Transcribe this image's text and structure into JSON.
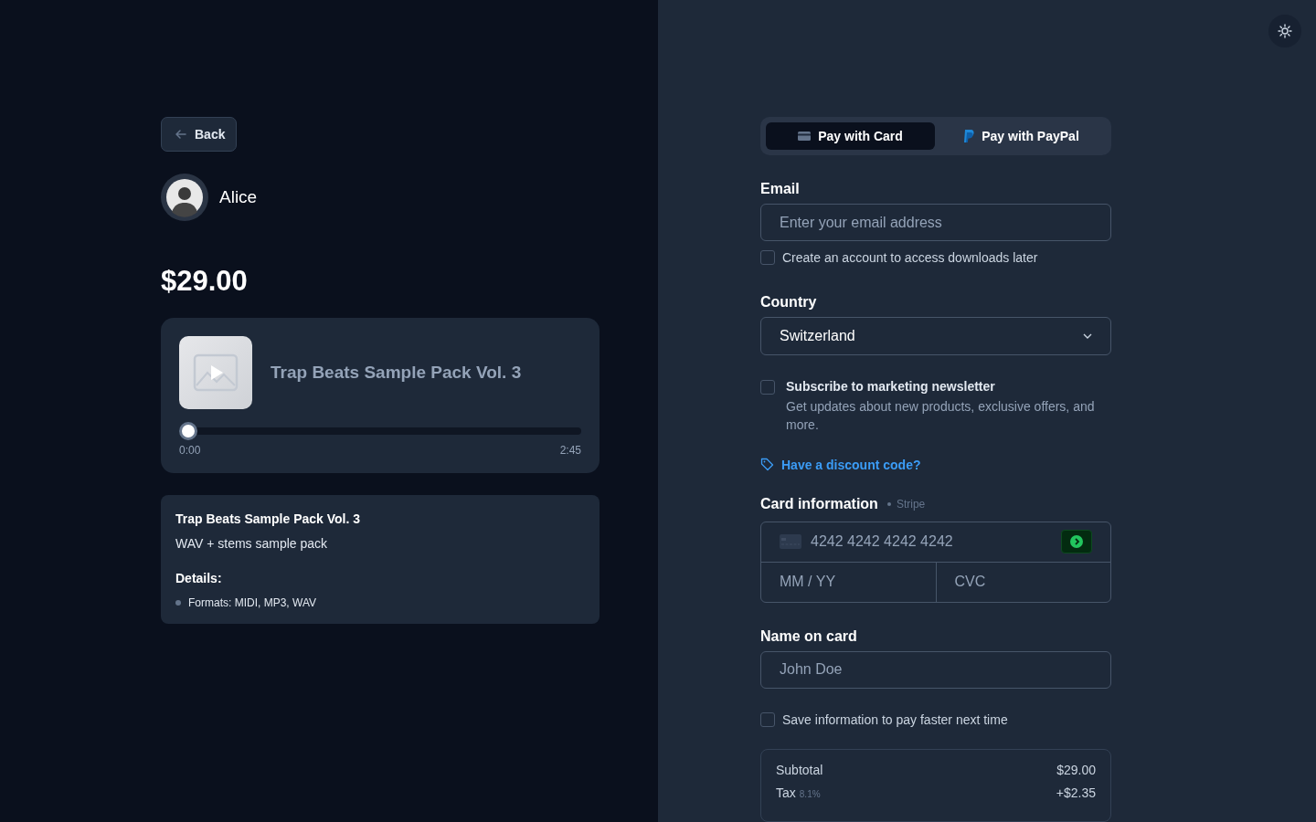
{
  "back_button": {
    "label": "Back"
  },
  "seller": {
    "name": "Alice"
  },
  "price": "$29.00",
  "player": {
    "title": "Trap Beats Sample Pack Vol. 3",
    "level": 0,
    "elapsed": "0:00",
    "duration": "2:45"
  },
  "product": {
    "title": "Trap Beats Sample Pack Vol. 3",
    "subtitle": "WAV + stems sample pack",
    "details_heading": "Details:",
    "details": [
      "Formats: MIDI, MP3, WAV"
    ]
  },
  "payment_tabs": [
    {
      "label": "Pay with Card",
      "kind": "card",
      "selected": true
    },
    {
      "label": "Pay with PayPal",
      "kind": "paypal",
      "selected": false
    }
  ],
  "email": {
    "label": "Email",
    "placeholder": "Enter your email address"
  },
  "create_account": {
    "label": "Create an account to access downloads later",
    "checked": false
  },
  "country": {
    "label": "Country",
    "value": "Switzerland"
  },
  "newsletter": {
    "label": "Subscribe to marketing newsletter",
    "description": "Get updates about new products, exclusive offers, and more.",
    "checked": false
  },
  "discount_link": "Have a discount code?",
  "card": {
    "label": "Card information",
    "provider": "Stripe",
    "number_placeholder": "4242 4242 4242 4242",
    "expiry_placeholder": "MM / YY",
    "cvc_placeholder": "CVC"
  },
  "name_on_card": {
    "label": "Name on card",
    "placeholder": "John Doe"
  },
  "save_info": {
    "label": "Save information to pay faster next time",
    "checked": false
  },
  "summary": [
    {
      "label": "Subtotal",
      "value": "$29.00"
    },
    {
      "label": "Tax",
      "note": "8.1%",
      "value": "+$2.35"
    }
  ]
}
